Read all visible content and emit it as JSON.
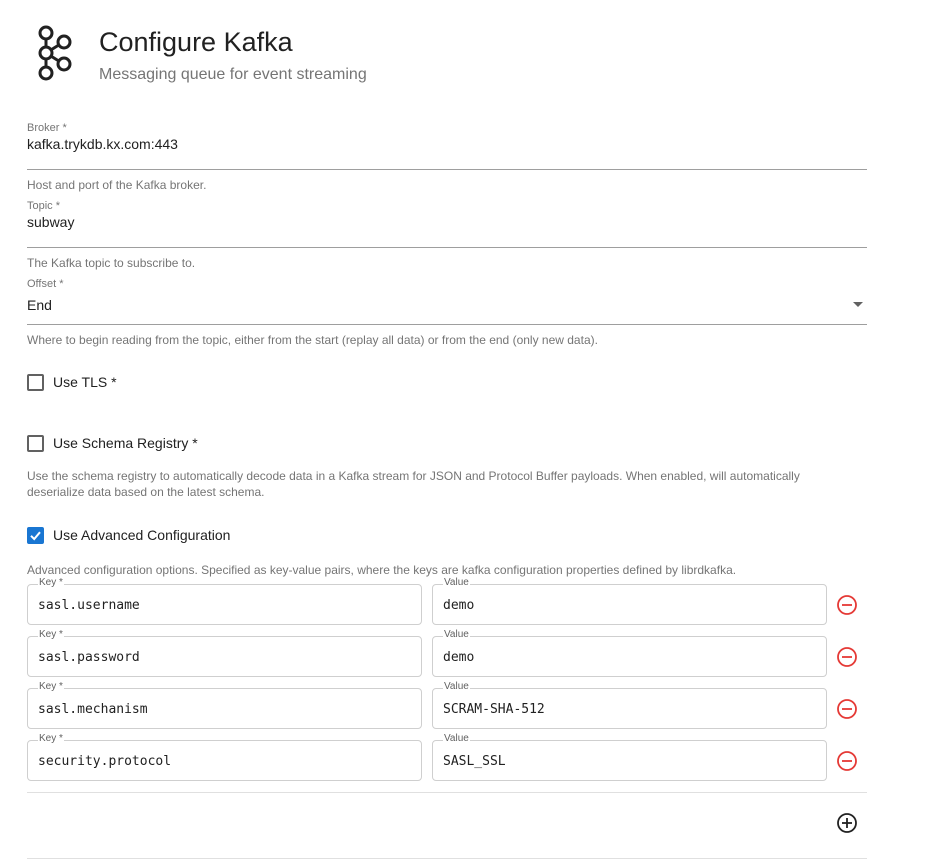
{
  "header": {
    "title": "Configure Kafka",
    "subtitle": "Messaging queue for event streaming",
    "logo_icon": "kafka-logo-icon"
  },
  "fields": {
    "broker": {
      "label": "Broker *",
      "value": "kafka.trykdb.kx.com:443",
      "hint": "Host and port of the Kafka broker."
    },
    "topic": {
      "label": "Topic *",
      "value": "subway",
      "hint": "The Kafka topic to subscribe to."
    },
    "offset": {
      "label": "Offset *",
      "value": "End",
      "hint": "Where to begin reading from the topic, either from the start (replay all data) or from the end (only new data)."
    }
  },
  "options": {
    "use_tls": {
      "label": "Use TLS *",
      "checked": false
    },
    "use_schema_registry": {
      "label": "Use Schema Registry *",
      "checked": false,
      "description": "Use the schema registry to automatically decode data in a Kafka stream for JSON and Protocol Buffer payloads. When enabled, will automatically deserialize data based on the latest schema."
    },
    "use_advanced_configuration": {
      "label": "Use Advanced Configuration",
      "checked": true,
      "description": "Advanced configuration options. Specified as key-value pairs, where the keys are kafka configuration properties defined by librdkafka."
    }
  },
  "advanced": {
    "key_label": "Key *",
    "value_label": "Value",
    "rows": [
      {
        "key": "sasl.username",
        "value": "demo"
      },
      {
        "key": "sasl.password",
        "value": "demo"
      },
      {
        "key": "sasl.mechanism",
        "value": "SCRAM-SHA-512"
      },
      {
        "key": "security.protocol",
        "value": "SASL_SSL"
      }
    ]
  },
  "colors": {
    "accent": "#1976d2",
    "remove": "#e53935",
    "hint": "#757575"
  }
}
